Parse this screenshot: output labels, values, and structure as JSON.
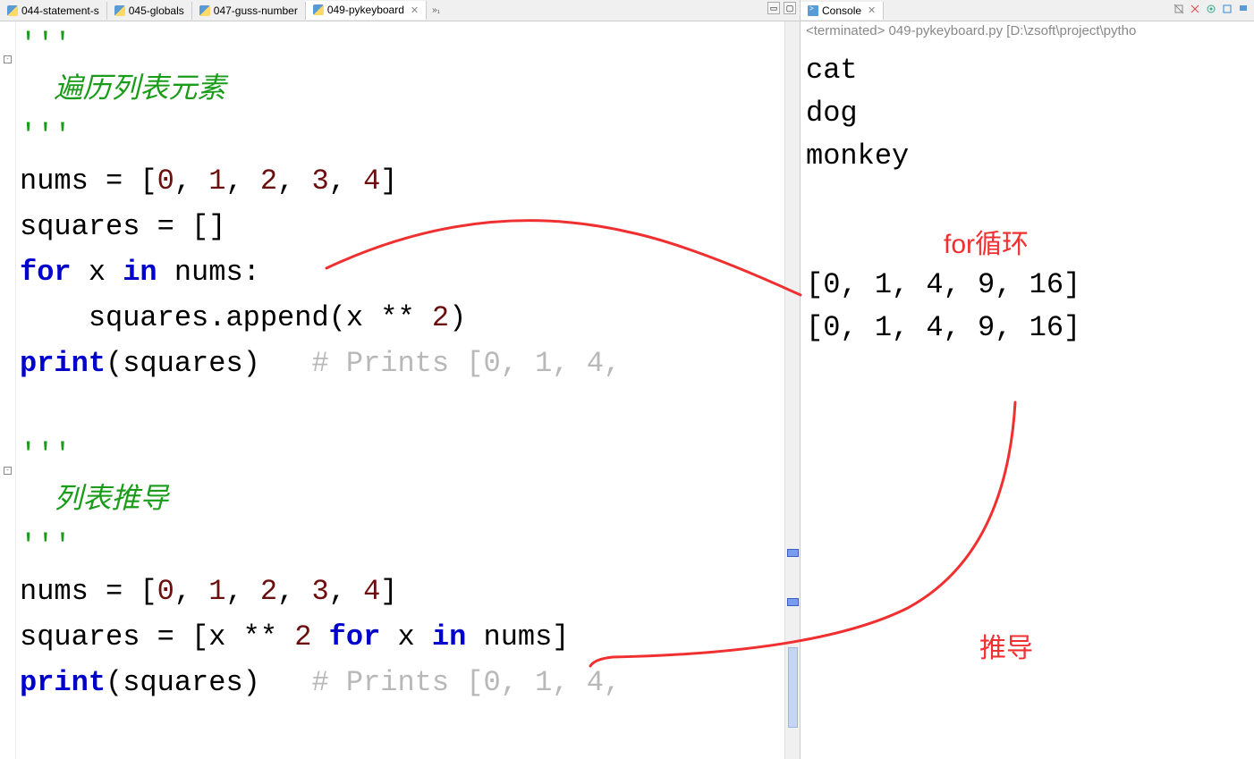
{
  "editor": {
    "tabs": [
      {
        "label": "044-statement-s"
      },
      {
        "label": "045-globals"
      },
      {
        "label": "047-guss-number"
      },
      {
        "label": "049-pykeyboard"
      }
    ],
    "active_tab_index": 3,
    "overflow_indicator": "»₁",
    "code_lines": [
      {
        "spans": [
          {
            "cls": "tok-str",
            "t": "'''"
          }
        ]
      },
      {
        "spans": [
          {
            "cls": "tok-strit",
            "t": "  遍历列表元素"
          }
        ]
      },
      {
        "spans": [
          {
            "cls": "tok-str",
            "t": "'''"
          }
        ]
      },
      {
        "spans": [
          {
            "cls": "tok-plain",
            "t": "nums = ["
          },
          {
            "cls": "tok-num",
            "t": "0"
          },
          {
            "cls": "tok-plain",
            "t": ", "
          },
          {
            "cls": "tok-num",
            "t": "1"
          },
          {
            "cls": "tok-plain",
            "t": ", "
          },
          {
            "cls": "tok-num",
            "t": "2"
          },
          {
            "cls": "tok-plain",
            "t": ", "
          },
          {
            "cls": "tok-num",
            "t": "3"
          },
          {
            "cls": "tok-plain",
            "t": ", "
          },
          {
            "cls": "tok-num",
            "t": "4"
          },
          {
            "cls": "tok-plain",
            "t": "]"
          }
        ]
      },
      {
        "spans": [
          {
            "cls": "tok-plain",
            "t": "squares = []"
          }
        ]
      },
      {
        "spans": [
          {
            "cls": "tok-kw",
            "t": "for"
          },
          {
            "cls": "tok-plain",
            "t": " x "
          },
          {
            "cls": "tok-kw",
            "t": "in"
          },
          {
            "cls": "tok-plain",
            "t": " nums:"
          }
        ]
      },
      {
        "spans": [
          {
            "cls": "tok-plain",
            "t": "    squares.append(x ** "
          },
          {
            "cls": "tok-num",
            "t": "2"
          },
          {
            "cls": "tok-plain",
            "t": ")"
          }
        ]
      },
      {
        "spans": [
          {
            "cls": "tok-kw",
            "t": "print"
          },
          {
            "cls": "tok-plain",
            "t": "(squares)   "
          },
          {
            "cls": "tok-comment",
            "t": "# Prints [0, 1, 4,"
          }
        ]
      },
      {
        "spans": [
          {
            "cls": "tok-plain",
            "t": ""
          }
        ]
      },
      {
        "spans": [
          {
            "cls": "tok-str",
            "t": "'''"
          }
        ]
      },
      {
        "spans": [
          {
            "cls": "tok-strit",
            "t": "  列表推导"
          }
        ]
      },
      {
        "spans": [
          {
            "cls": "tok-str",
            "t": "'''"
          }
        ]
      },
      {
        "spans": [
          {
            "cls": "tok-plain",
            "t": "nums = ["
          },
          {
            "cls": "tok-num",
            "t": "0"
          },
          {
            "cls": "tok-plain",
            "t": ", "
          },
          {
            "cls": "tok-num",
            "t": "1"
          },
          {
            "cls": "tok-plain",
            "t": ", "
          },
          {
            "cls": "tok-num",
            "t": "2"
          },
          {
            "cls": "tok-plain",
            "t": ", "
          },
          {
            "cls": "tok-num",
            "t": "3"
          },
          {
            "cls": "tok-plain",
            "t": ", "
          },
          {
            "cls": "tok-num",
            "t": "4"
          },
          {
            "cls": "tok-plain",
            "t": "]"
          }
        ]
      },
      {
        "spans": [
          {
            "cls": "tok-plain",
            "t": "squares = [x ** "
          },
          {
            "cls": "tok-num",
            "t": "2"
          },
          {
            "cls": "tok-plain",
            "t": " "
          },
          {
            "cls": "tok-kw",
            "t": "for"
          },
          {
            "cls": "tok-plain",
            "t": " x "
          },
          {
            "cls": "tok-kw",
            "t": "in"
          },
          {
            "cls": "tok-plain",
            "t": " nums]"
          }
        ]
      },
      {
        "spans": [
          {
            "cls": "tok-kw",
            "t": "print"
          },
          {
            "cls": "tok-plain",
            "t": "(squares)   "
          },
          {
            "cls": "tok-comment",
            "t": "# Prints [0, 1, 4,"
          }
        ]
      }
    ]
  },
  "console": {
    "tab_label": "Console",
    "terminated_text": "<terminated> 049-pykeyboard.py [D:\\zsoft\\project\\pytho",
    "output_lines": [
      "cat",
      "dog",
      "monkey",
      "",
      "",
      "[0, 1, 4, 9, 16]",
      "[0, 1, 4, 9, 16]"
    ]
  },
  "annotations": {
    "for_loop": "for循环",
    "comprehension": "推导"
  }
}
